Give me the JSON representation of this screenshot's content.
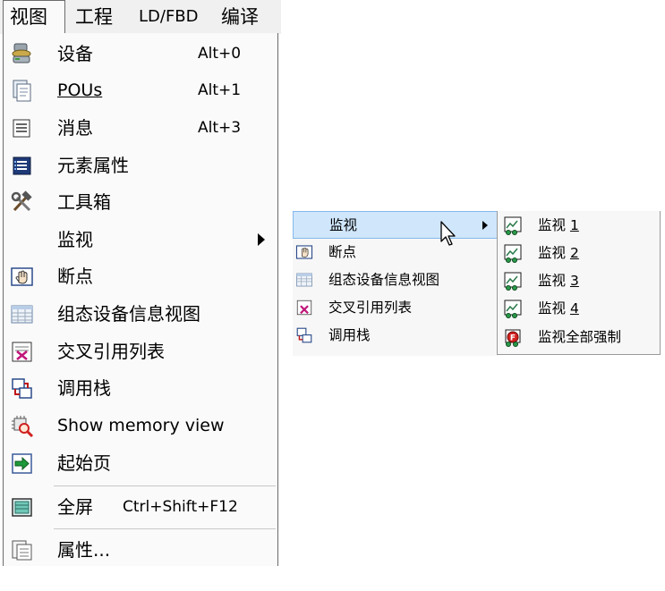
{
  "menubar": {
    "items": [
      {
        "label": "视图",
        "active": true
      },
      {
        "label": "工程"
      },
      {
        "label": "LD/FBD"
      },
      {
        "label": "编译"
      }
    ]
  },
  "view_menu": {
    "items": [
      {
        "label": "设备",
        "shortcut": "Alt+0",
        "icon": "devices-icon"
      },
      {
        "label": "POUs",
        "shortcut": "Alt+1",
        "icon": "pous-icon"
      },
      {
        "label": "消息",
        "shortcut": "Alt+3",
        "icon": "messages-icon"
      },
      {
        "label": "元素属性",
        "icon": "element-properties-icon"
      },
      {
        "label": "工具箱",
        "icon": "toolbox-icon"
      },
      {
        "label": "监视",
        "has_submenu": true
      },
      {
        "label": "断点",
        "icon": "breakpoint-icon"
      },
      {
        "label": "组态设备信息视图",
        "icon": "config-device-info-icon"
      },
      {
        "label": "交叉引用列表",
        "icon": "cross-reference-icon"
      },
      {
        "label": "调用栈",
        "icon": "call-stack-icon"
      },
      {
        "label": "Show memory view",
        "icon": "memory-view-icon"
      },
      {
        "label": "起始页",
        "icon": "start-page-icon"
      },
      {
        "label": "全屏",
        "shortcut": "Ctrl+Shift+F12",
        "icon": "fullscreen-icon"
      },
      {
        "label": "属性...",
        "icon": "properties-icon"
      }
    ]
  },
  "context_menu": {
    "items": [
      {
        "label": "监视",
        "highlighted": true,
        "has_submenu": true
      },
      {
        "label": "断点",
        "icon": "breakpoint-icon"
      },
      {
        "label": "组态设备信息视图",
        "icon": "config-device-info-icon"
      },
      {
        "label": "交叉引用列表",
        "icon": "cross-reference-icon"
      },
      {
        "label": "调用栈",
        "icon": "call-stack-icon"
      }
    ]
  },
  "watch_submenu": {
    "items": [
      {
        "label": "监视",
        "number": "1"
      },
      {
        "label": "监视",
        "number": "2"
      },
      {
        "label": "监视",
        "number": "3"
      },
      {
        "label": "监视",
        "number": "4"
      },
      {
        "label": "监视全部强制"
      }
    ]
  },
  "colors": {
    "menu_bg": "#fafafa",
    "highlight_bg": "#cfe6fb",
    "highlight_border": "#84b8ea",
    "separator": "#c8c8c8"
  }
}
